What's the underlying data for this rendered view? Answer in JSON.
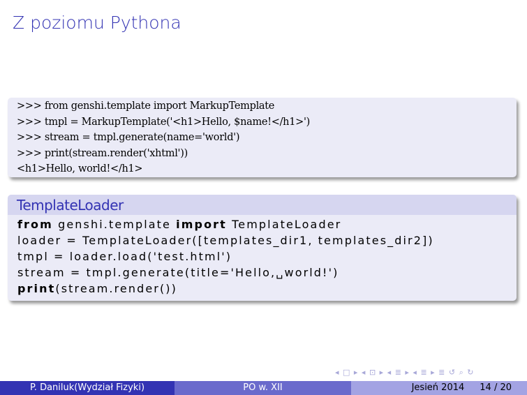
{
  "slide": {
    "title": "Z poziomu Pythona"
  },
  "block1": {
    "lines": [
      ">>> from genshi.template import MarkupTemplate",
      ">>> tmpl = MarkupTemplate('<h1>Hello, $name!</h1>')",
      ">>> stream = tmpl.generate(name='world')",
      ">>> print(stream.render('xhtml'))",
      "<h1>Hello, world!</h1>"
    ]
  },
  "block2": {
    "title": "TemplateLoader",
    "line1_kw1": "from",
    "line1_a": " genshi.template ",
    "line1_kw2": "import",
    "line1_b": " TemplateLoader",
    "line2": "loader = TemplateLoader([templates_dir1, templates_dir2])",
    "line3": "tmpl = loader.load('test.html')",
    "line4": "stream = tmpl.generate(title='Hello,␣world!')",
    "line5_kw": "print",
    "line5_rest": "(stream.render())"
  },
  "nav": {
    "symbols": "◂ □ ▸ ◂ ⊡ ▸ ◂ ≣ ▸ ◂ ≣ ▸   ≣   ↺ ⌕ ↻"
  },
  "footer": {
    "author": "P. Daniluk(Wydział Fizyki)",
    "course": "PO w. XII",
    "date": "Jesień 2014",
    "page": "14 / 20"
  }
}
